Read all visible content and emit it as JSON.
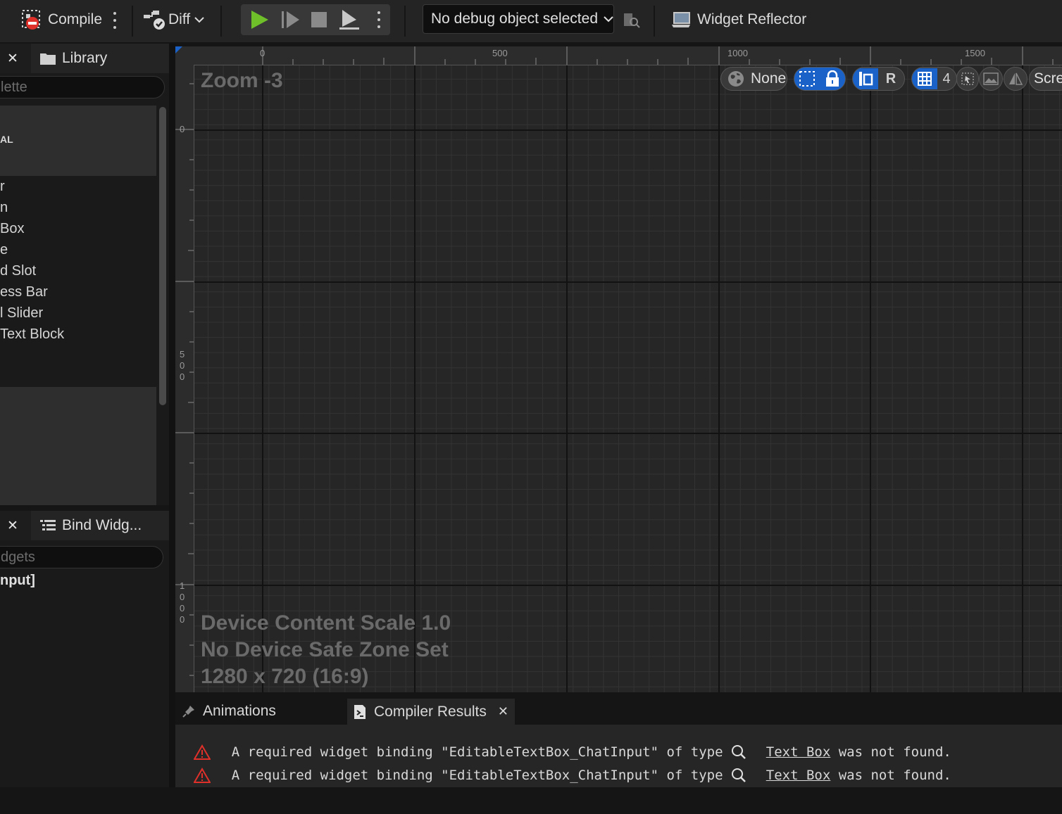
{
  "toolbar": {
    "compile_label": "Compile",
    "diff_label": "Diff",
    "debug_selector_value": "No debug object selected",
    "widget_reflector_label": "Widget Reflector"
  },
  "palette_panel": {
    "tab_label": "Library",
    "search_placeholder": "lette",
    "category_label": "AL",
    "items": [
      "r",
      "n",
      " Box",
      "e",
      "d Slot",
      "ess Bar",
      "l Slider",
      "Text Block"
    ]
  },
  "hierarchy_panel": {
    "tab_label": "Bind Widg...",
    "search_placeholder": "dgets",
    "root_item": "nput]"
  },
  "designer": {
    "zoom_label": "Zoom -3",
    "ruler_top_ticks": [
      "0",
      "500",
      "1000",
      "1500"
    ],
    "ruler_left_ticks": [
      "0",
      "5\n0\n0",
      "1\n0\n0\n0"
    ],
    "toolbar": {
      "world_label": "None",
      "r_label": "R",
      "grid_snap_value": "4",
      "screen_label": "Scre"
    },
    "info_lines": [
      "Device Content Scale 1.0",
      "No Device Safe Zone Set",
      "1280 x 720 (16:9)"
    ]
  },
  "bottom_panel": {
    "tabs": [
      {
        "label": "Animations",
        "active": false
      },
      {
        "label": "Compiler Results",
        "active": true
      }
    ],
    "messages": [
      {
        "prefix": "A required widget binding \"EditableTextBox_ChatInput\" of type ",
        "type_link": "Text Box",
        "suffix": " was not found."
      },
      {
        "prefix": "A required widget binding \"EditableTextBox_ChatInput\" of type ",
        "type_link": "Text Box",
        "suffix": " was not found."
      }
    ]
  },
  "colors": {
    "accent_blue": "#1b62c8",
    "play_green": "#6fbf2a",
    "error_red": "#e0302a"
  }
}
